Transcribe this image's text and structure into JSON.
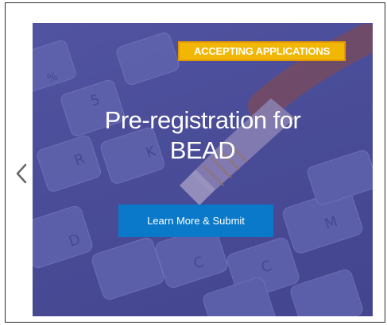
{
  "carousel": {
    "prev_icon": "chevron-left-icon",
    "slide": {
      "badge": "ACCEPTING APPLICATIONS",
      "title_line1": "Pre-registration for",
      "title_line2": "BEAD",
      "cta_label": "Learn More & Submit",
      "background_image": "keyboard-with-ethernet-cable"
    }
  },
  "colors": {
    "overlay": "#4a4c98",
    "badge_bg": "#f2b705",
    "badge_border": "#e69a00",
    "cta_bg": "#0a79c9",
    "arrow": "#666666"
  }
}
